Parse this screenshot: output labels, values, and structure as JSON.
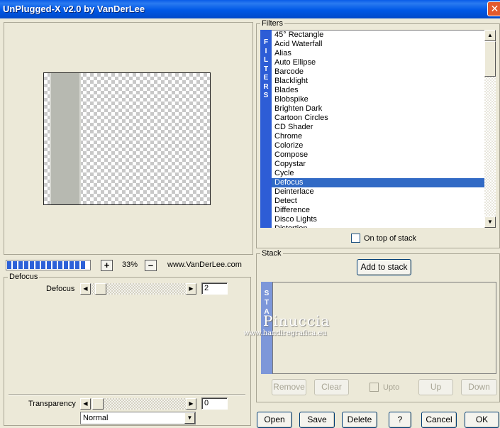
{
  "window": {
    "title": "UnPlugged-X v2.0 by VanDerLee",
    "close_glyph": "✕"
  },
  "preview": {
    "zoom": "33%",
    "zoom_in": "+",
    "zoom_out": "–",
    "website": "www.VanDerLee.com"
  },
  "settings": {
    "group_label": "Defocus",
    "param_label": "Defocus",
    "param_value": "2",
    "transparency_label": "Transparency",
    "transparency_value": "0",
    "blend_mode": "Normal"
  },
  "filters": {
    "group_label": "Filters",
    "tab_letters": [
      "F",
      "I",
      "L",
      "T",
      "E",
      "R",
      "S"
    ],
    "items": [
      "45° Rectangle",
      "Acid Waterfall",
      "Alias",
      "Auto Ellipse",
      "Barcode",
      "Blacklight",
      "Blades",
      "Blobspike",
      "Brighten Dark",
      "Cartoon Circles",
      "CD Shader",
      "Chrome",
      "Colorize",
      "Compose",
      "Copystar",
      "Cycle",
      "Defocus",
      "Deinterlace",
      "Detect",
      "Difference",
      "Disco Lights",
      "Distortion"
    ],
    "selected": "Defocus",
    "on_top_label": "On top of stack"
  },
  "stack": {
    "group_label": "Stack",
    "add_label": "Add to stack",
    "tab_letters": [
      "S",
      "T",
      "A"
    ],
    "remove_label": "Remove",
    "clear_label": "Clear",
    "upto_label": "Upto",
    "up_label": "Up",
    "down_label": "Down"
  },
  "footer": {
    "open_label": "Open",
    "save_label": "Save",
    "delete_label": "Delete",
    "help_label": "?",
    "cancel_label": "Cancel",
    "ok_label": "OK"
  },
  "watermark": {
    "name": "Pinuccia",
    "url": "www.handiregrafica.eu"
  },
  "colors": {
    "titlebar": "#0058e6",
    "selection": "#316ac5",
    "filters_tab": "#2d5dd6",
    "stack_tab": "#7d97d9",
    "progress": "#2d61d8"
  }
}
